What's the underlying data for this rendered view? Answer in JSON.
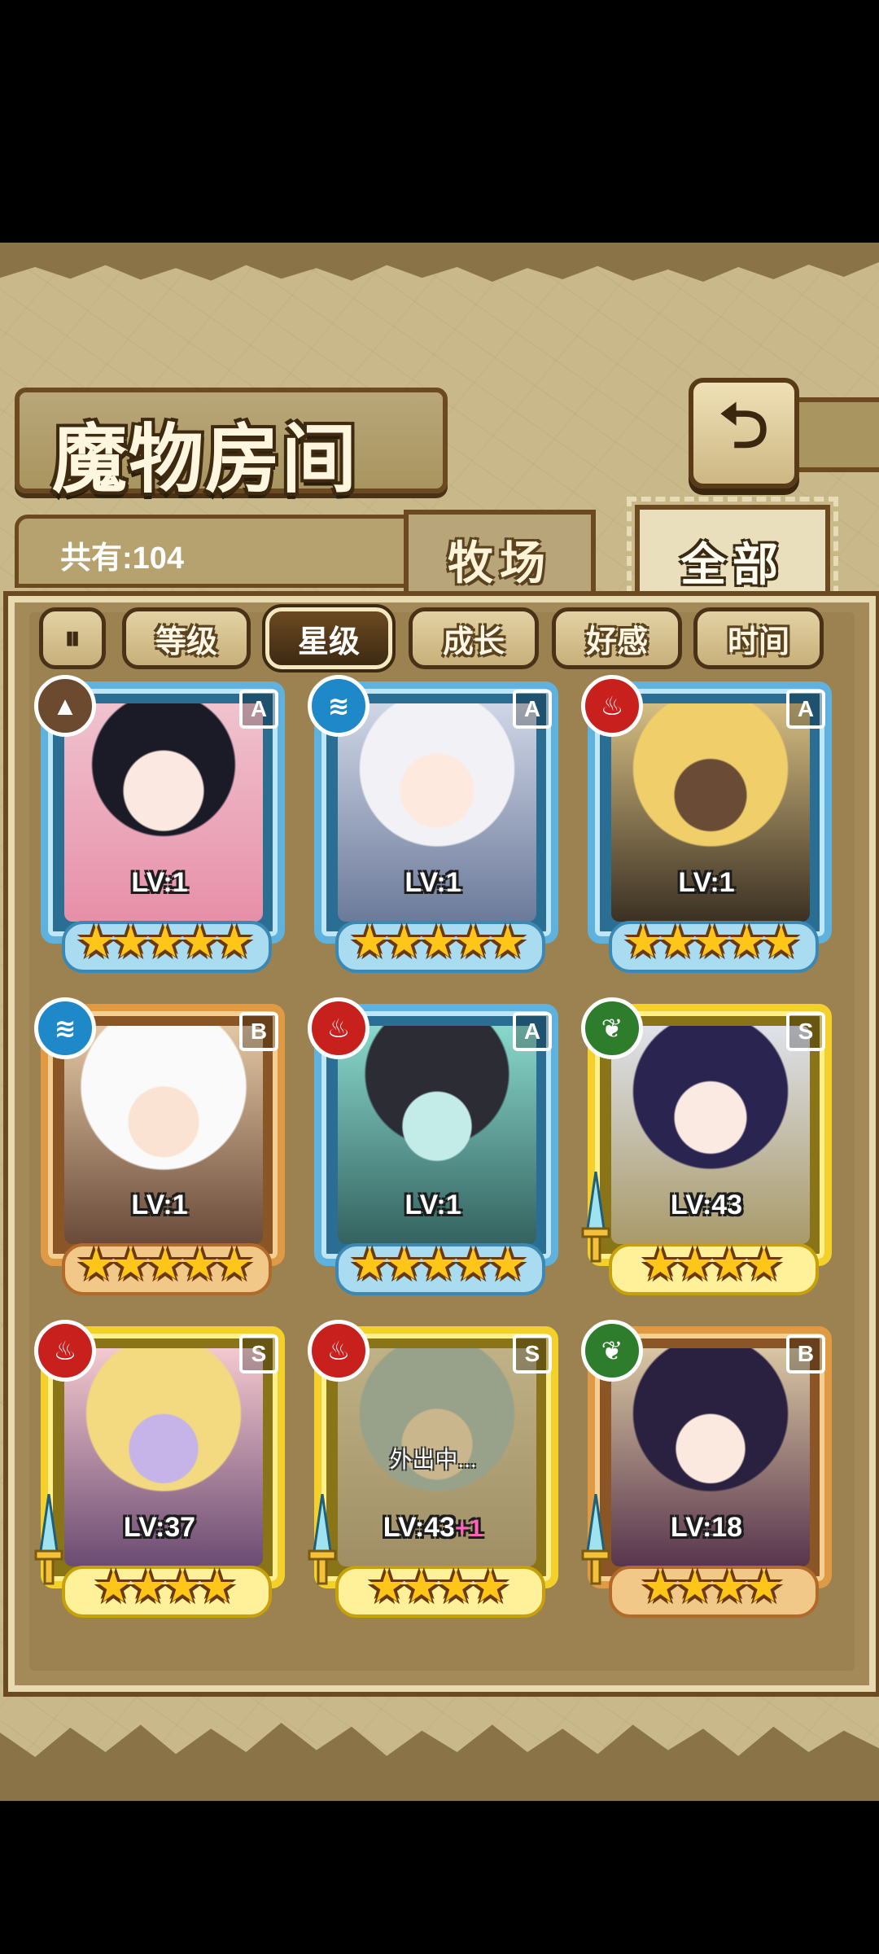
{
  "header": {
    "title": "魔物房间",
    "back_icon": "back-arrow-icon",
    "count_label": "共有:104"
  },
  "tabs": [
    {
      "label": "牧场",
      "active": false
    },
    {
      "label": "全部",
      "active": true
    }
  ],
  "filters": {
    "sort_toggle_icon": "sort-toggle-icon",
    "items": [
      {
        "label": "等级",
        "selected": false
      },
      {
        "label": "星级",
        "selected": true
      },
      {
        "label": "成长",
        "selected": false
      },
      {
        "label": "好感",
        "selected": false
      },
      {
        "label": "时间",
        "selected": false
      }
    ]
  },
  "monsters": [
    {
      "element": "earth",
      "rank": "A",
      "level": "LV:1",
      "stars": "★★★★★",
      "frame": "blue"
    },
    {
      "element": "water",
      "rank": "A",
      "level": "LV:1",
      "stars": "★★★★★",
      "frame": "blue"
    },
    {
      "element": "fire",
      "rank": "A",
      "level": "LV:1",
      "stars": "★★★★★",
      "frame": "blue"
    },
    {
      "element": "water",
      "rank": "B",
      "level": "LV:1",
      "stars": "★★★★★",
      "frame": "bronze"
    },
    {
      "element": "fire",
      "rank": "A",
      "level": "LV:1",
      "stars": "★★★★★",
      "frame": "blue"
    },
    {
      "element": "wood",
      "rank": "S",
      "level": "LV:43",
      "stars": "★★★★",
      "frame": "gold",
      "sword": true
    },
    {
      "element": "fire",
      "rank": "S",
      "level": "LV:37",
      "stars": "★★★★",
      "frame": "gold",
      "sword": true
    },
    {
      "element": "fire",
      "rank": "S",
      "level": "LV:43",
      "level_bonus": "+1",
      "stars": "★★★★",
      "frame": "gold",
      "sword": true,
      "status": "外出中..."
    },
    {
      "element": "wood",
      "rank": "B",
      "level": "LV:18",
      "stars": "★★★★",
      "frame": "bronze",
      "sword": true
    }
  ],
  "colors": {
    "frame_blue": "#5fb2dd",
    "frame_bronze": "#e09a44",
    "frame_gold": "#f3d12a",
    "star": "#ffc61a",
    "element_fire": "#c8201c",
    "element_water": "#1f88c9",
    "element_wood": "#2e7d2c",
    "element_earth": "#6b4a30"
  }
}
